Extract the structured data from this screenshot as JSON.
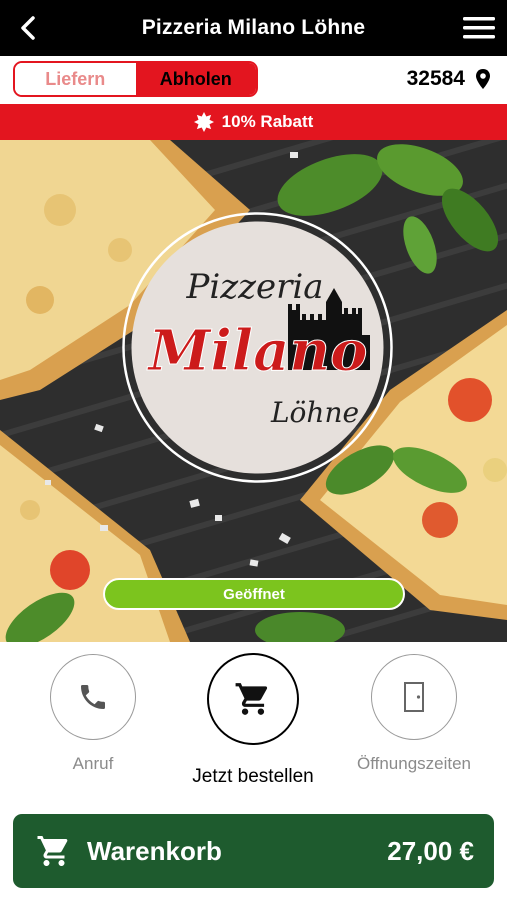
{
  "header": {
    "title": "Pizzeria Milano Löhne",
    "back_icon": "chevron-left-icon",
    "menu_icon": "hamburger-menu-icon"
  },
  "order_mode": {
    "options": [
      {
        "label": "Liefern",
        "selected": false
      },
      {
        "label": "Abholen",
        "selected": true
      }
    ],
    "accent_color": "#e3151f"
  },
  "location": {
    "zip": "32584",
    "icon": "map-pin-icon"
  },
  "banner": {
    "icon": "badge-star-icon",
    "text": "10% Rabatt",
    "color": "#e3151f"
  },
  "hero": {
    "logo": {
      "line1": "Pizzeria",
      "line2": "Milano",
      "line3": "Löhne"
    },
    "status": {
      "label": "Geöffnet",
      "color": "#7cc41e"
    }
  },
  "actions": [
    {
      "label": "Anruf",
      "icon": "phone-icon"
    },
    {
      "label": "Jetzt bestellen",
      "icon": "cart-icon"
    },
    {
      "label": "Öffnungszeiten",
      "icon": "door-icon"
    }
  ],
  "cart": {
    "label": "Warenkorb",
    "total": "27,00 €",
    "icon": "cart-icon",
    "color": "#1e5b2e"
  }
}
